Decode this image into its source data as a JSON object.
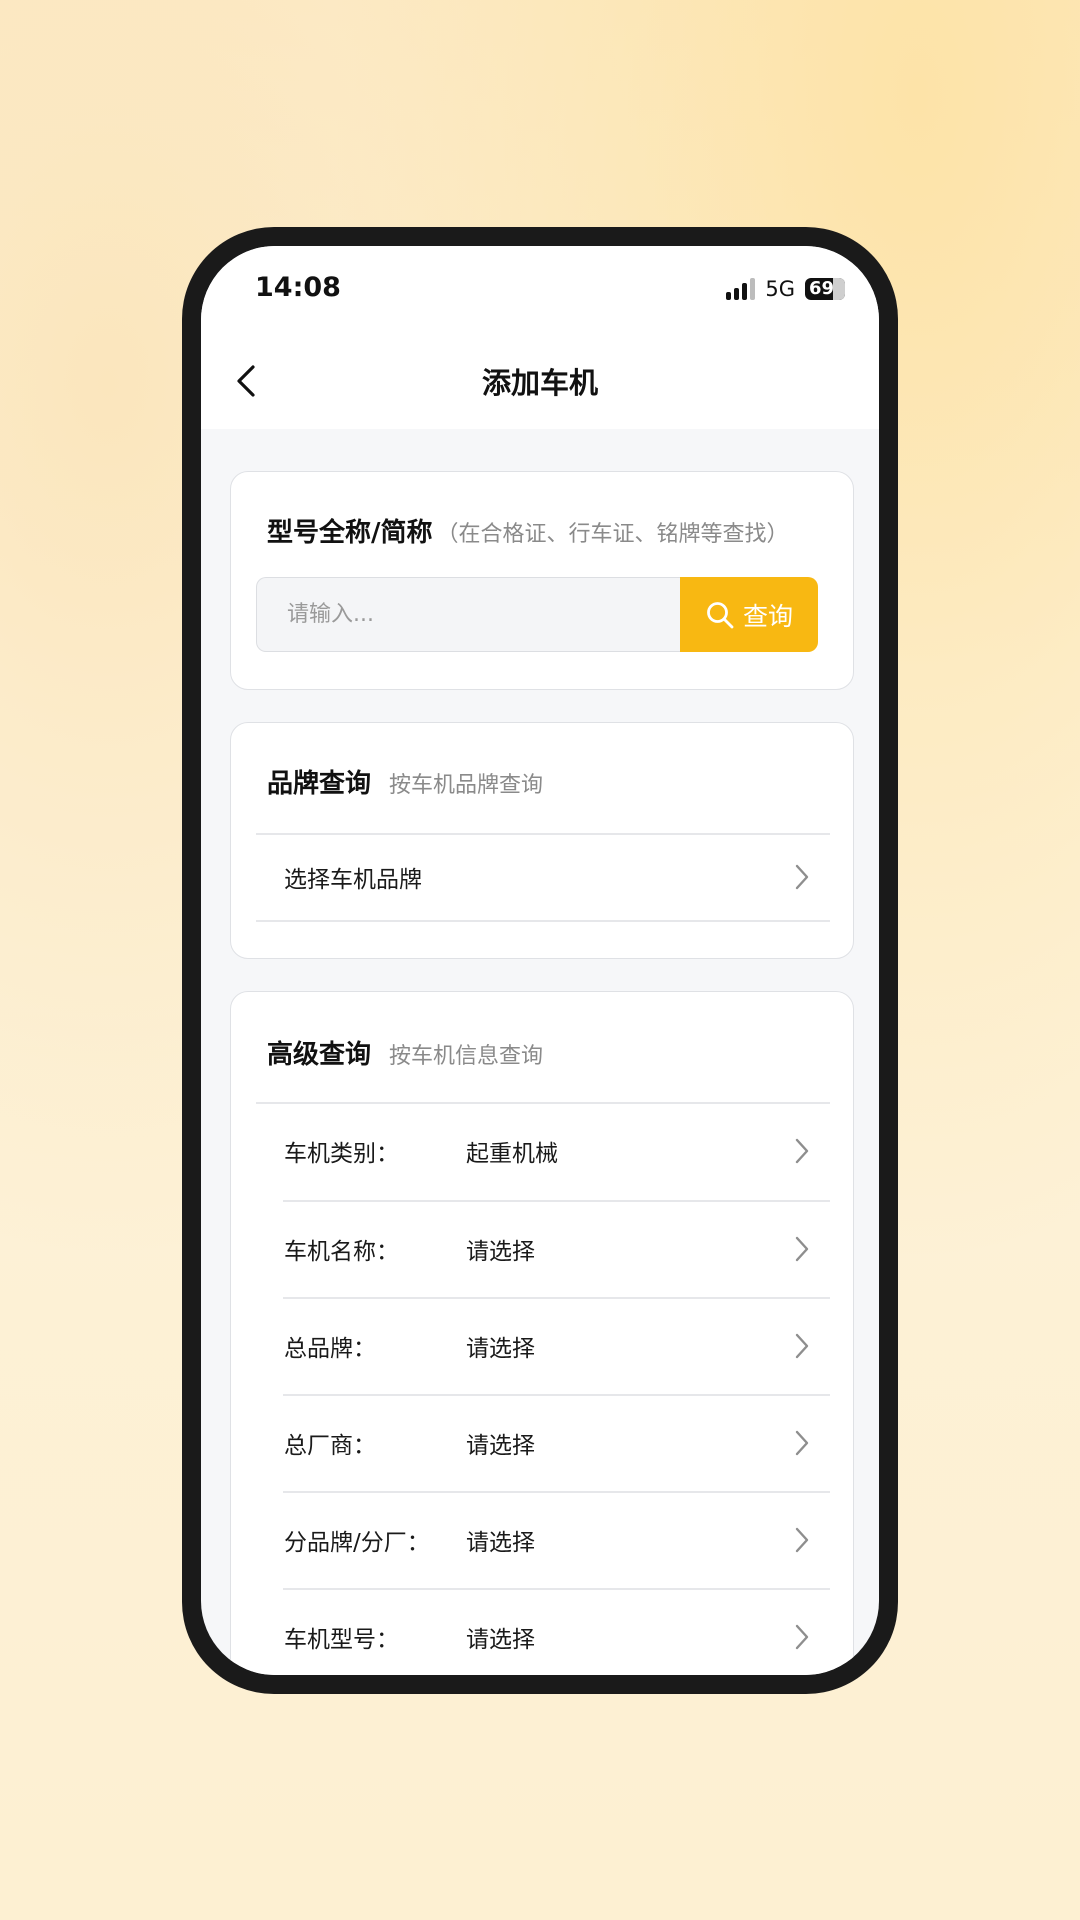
{
  "status_bar": {
    "time": "14:08",
    "network": "5G",
    "battery": "69"
  },
  "nav": {
    "title": "添加车机"
  },
  "model_search": {
    "title": "型号全称/简称",
    "hint": "（在合格证、行车证、铭牌等查找）",
    "placeholder": "请输入...",
    "button_label": "查询"
  },
  "brand_query": {
    "title": "品牌查询",
    "subtitle": "按车机品牌查询",
    "select_label": "选择车机品牌"
  },
  "advanced_query": {
    "title": "高级查询",
    "subtitle": "按车机信息查询",
    "rows": [
      {
        "label": "车机类别：",
        "value": "起重机械"
      },
      {
        "label": "车机名称：",
        "value": "请选择"
      },
      {
        "label": "总品牌：",
        "value": "请选择"
      },
      {
        "label": "总厂商：",
        "value": "请选择"
      },
      {
        "label": "分品牌/分厂：",
        "value": "请选择"
      },
      {
        "label": "车机型号：",
        "value": "请选择"
      }
    ]
  },
  "colors": {
    "accent": "#f8b812",
    "frame": "#1a1a1a",
    "page_bg": "#f6f7f9"
  },
  "icons": {
    "back": "chevron-left-icon",
    "search": "search-icon",
    "row": "chevron-right-icon"
  }
}
